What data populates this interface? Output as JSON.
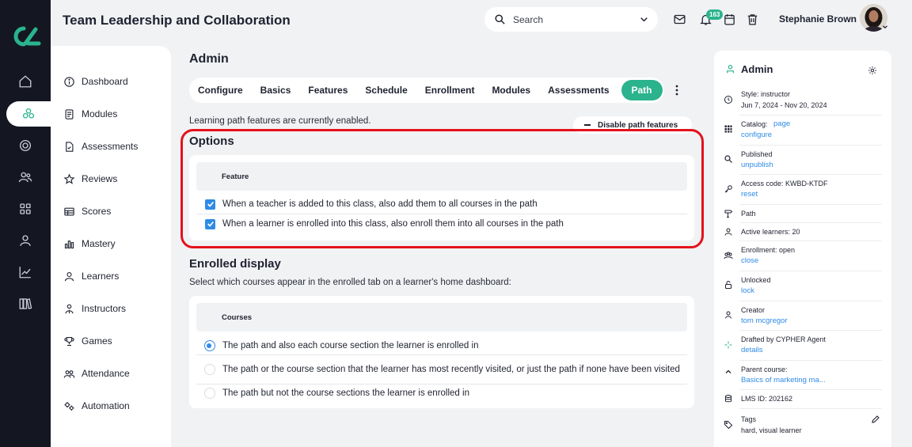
{
  "header": {
    "title": "Team Leadership and Collaboration",
    "search_placeholder": "Search",
    "notification_count": "163",
    "user_name": "Stephanie Brown"
  },
  "sidebar": {
    "items": [
      {
        "label": "Dashboard",
        "icon": "info-circle-icon"
      },
      {
        "label": "Modules",
        "icon": "document-icon"
      },
      {
        "label": "Assessments",
        "icon": "file-check-icon"
      },
      {
        "label": "Reviews",
        "icon": "star-icon"
      },
      {
        "label": "Scores",
        "icon": "table-icon"
      },
      {
        "label": "Mastery",
        "icon": "bar-chart-icon"
      },
      {
        "label": "Learners",
        "icon": "person-icon"
      },
      {
        "label": "Instructors",
        "icon": "instructor-icon"
      },
      {
        "label": "Games",
        "icon": "trophy-icon"
      },
      {
        "label": "Attendance",
        "icon": "group-icon"
      },
      {
        "label": "Automation",
        "icon": "gears-icon"
      }
    ]
  },
  "main": {
    "title": "Admin",
    "tabs": [
      {
        "label": "Configure",
        "active": false
      },
      {
        "label": "Basics",
        "active": false
      },
      {
        "label": "Features",
        "active": false
      },
      {
        "label": "Schedule",
        "active": false
      },
      {
        "label": "Enrollment",
        "active": false
      },
      {
        "label": "Modules",
        "active": false
      },
      {
        "label": "Assessments",
        "active": false
      },
      {
        "label": "Path",
        "active": true
      }
    ],
    "notice": "Learning path features are currently enabled.",
    "disable_button": "Disable path features",
    "options": {
      "title": "Options",
      "column": "Feature",
      "rows": [
        {
          "label": "When a teacher is added to this class, also add them to all courses in the path",
          "checked": true
        },
        {
          "label": "When a learner is enrolled into this class, also enroll them into all courses in the path",
          "checked": true
        }
      ]
    },
    "enrolled": {
      "title": "Enrolled display",
      "subtitle": "Select which courses appear in the enrolled tab on a learner's home dashboard:",
      "column": "Courses",
      "rows": [
        {
          "label": "The path and also each course section the learner is enrolled in",
          "selected": true
        },
        {
          "label": "The path or the course section that the learner has most recently visited, or just the path if none have been visited",
          "selected": false
        },
        {
          "label": "The path but not the course sections the learner is enrolled in",
          "selected": false
        }
      ]
    }
  },
  "panel": {
    "title": "Admin",
    "style": "Style: instructor",
    "dates": "Jun 7, 2024 - Nov 20, 2024",
    "catalog": "Catalog:",
    "catalog_page": "page",
    "catalog_configure": "configure",
    "published": "Published",
    "unpublish": "unpublish",
    "access_code": "Access code: KWBD-KTDF",
    "reset": "reset",
    "path": "Path",
    "active_learners": "Active learners: 20",
    "enrollment": "Enrollment: open",
    "close": "close",
    "unlocked": "Unlocked",
    "lock": "lock",
    "creator": "Creator",
    "creator_name": "tom mcgregor",
    "drafted": "Drafted by CYPHER Agent",
    "details": "details",
    "parent": "Parent course:",
    "parent_name": "Basics of marketing ma...",
    "lms_id": "LMS ID: 202162",
    "tags": "Tags",
    "tags_value": "hard, visual learner"
  },
  "colors": {
    "accent": "#2ab38d",
    "link": "#2f8be6",
    "rail": "#141722",
    "highlight": "#e4121b"
  }
}
